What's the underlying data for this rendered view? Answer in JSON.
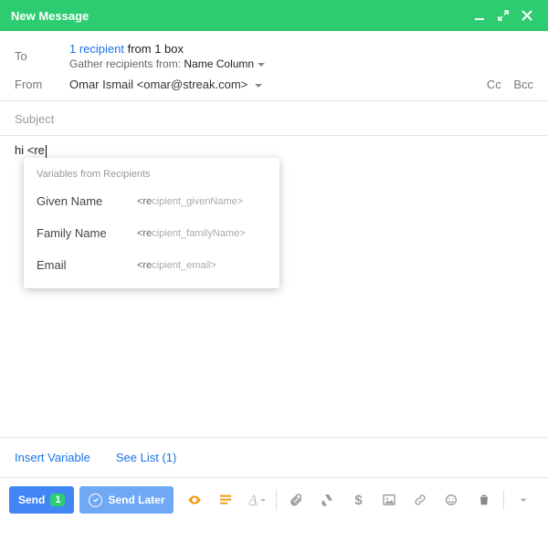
{
  "titlebar": {
    "title": "New Message"
  },
  "recipients": {
    "to_label": "To",
    "link_text": "1 recipient",
    "rest_text": " from 1 box",
    "gather_label": "Gather recipients from: ",
    "gather_source": "Name Column"
  },
  "from": {
    "label": "From",
    "value": "Omar Ismail <omar@streak.com>"
  },
  "ccbcc": {
    "cc": "Cc",
    "bcc": "Bcc"
  },
  "subject": {
    "placeholder": "Subject"
  },
  "body": {
    "text": "hi <re"
  },
  "popover": {
    "header": "Variables from Recipients",
    "items": [
      {
        "label": "Given Name",
        "prefix": "<re",
        "suffix": "cipient_givenName>"
      },
      {
        "label": "Family Name",
        "prefix": "<re",
        "suffix": "cipient_familyName>"
      },
      {
        "label": "Email",
        "prefix": "<re",
        "suffix": "cipient_email>"
      }
    ]
  },
  "linksrow": {
    "insert_variable": "Insert Variable",
    "see_list": "See List (1)"
  },
  "toolbar": {
    "send_label": "Send",
    "send_count": "1",
    "send_later_label": "Send Later"
  }
}
